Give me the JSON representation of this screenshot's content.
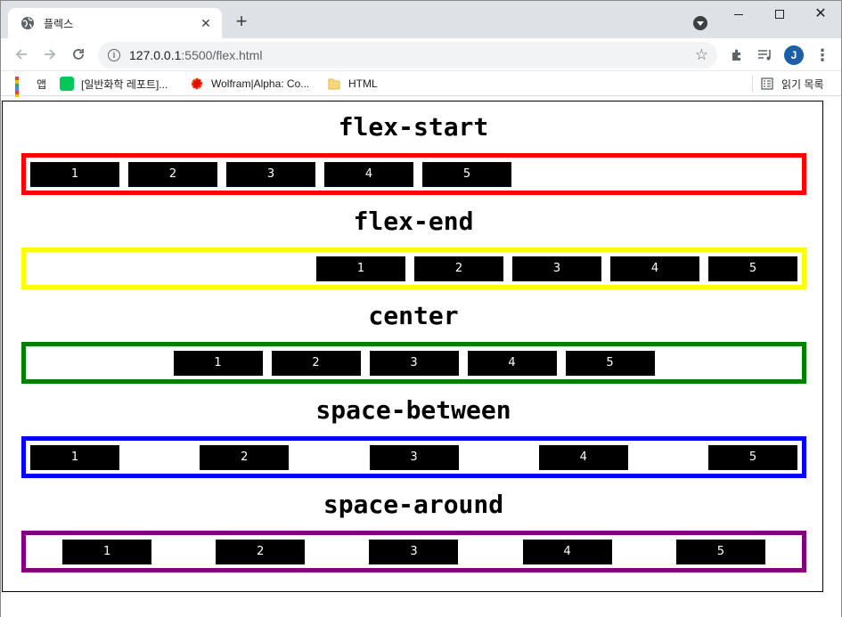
{
  "browser": {
    "tab_title": "플렉스",
    "url_host": "127.0.0.1",
    "url_path": ":5500/flex.html",
    "avatar_letter": "J",
    "bookmarks": {
      "apps": "앱",
      "blog": "[일반화학 레포트]...",
      "wolfram": "Wolfram|Alpha: Co...",
      "html": "HTML",
      "reading_list": "읽기 목록"
    }
  },
  "page": {
    "sections": [
      {
        "title": "flex-start",
        "border_color": "#ff0000",
        "items": [
          "1",
          "2",
          "3",
          "4",
          "5"
        ]
      },
      {
        "title": "flex-end",
        "border_color": "#ffff00",
        "items": [
          "1",
          "2",
          "3",
          "4",
          "5"
        ]
      },
      {
        "title": "center",
        "border_color": "#008000",
        "items": [
          "1",
          "2",
          "3",
          "4",
          "5"
        ]
      },
      {
        "title": "space-between",
        "border_color": "#0000ff",
        "items": [
          "1",
          "2",
          "3",
          "4",
          "5"
        ]
      },
      {
        "title": "space-around",
        "border_color": "#800080",
        "items": [
          "1",
          "2",
          "3",
          "4",
          "5"
        ]
      }
    ]
  },
  "icons": {
    "tab": "globe-icon",
    "toolbar": [
      "back-arrow-icon",
      "forward-arrow-icon",
      "reload-icon",
      "info-icon",
      "star-icon",
      "puzzle-icon",
      "media-queue-icon",
      "kebab-menu-icon"
    ]
  }
}
